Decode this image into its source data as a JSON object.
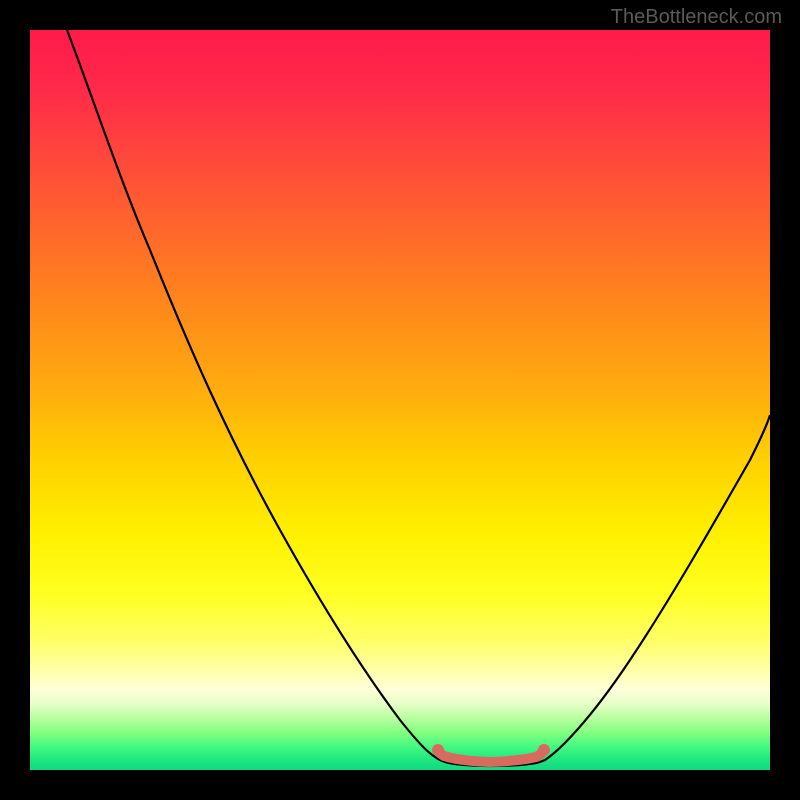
{
  "watermark": "TheBottleneck.com",
  "chart_data": {
    "type": "line",
    "title": "",
    "xlabel": "",
    "ylabel": "",
    "xlim": [
      0,
      100
    ],
    "ylim": [
      0,
      100
    ],
    "series": [
      {
        "name": "bottleneck-curve",
        "x": [
          5,
          10,
          15,
          20,
          25,
          30,
          35,
          40,
          45,
          50,
          53,
          55,
          58,
          61,
          64,
          67,
          70,
          75,
          80,
          85,
          90,
          95,
          100
        ],
        "y": [
          100,
          90,
          80,
          70,
          60,
          50,
          41,
          32,
          23,
          14,
          8,
          5,
          2,
          0,
          0,
          0,
          1,
          5,
          13,
          23,
          34,
          45,
          56
        ]
      },
      {
        "name": "optimal-zone-marker",
        "x": [
          55,
          56,
          58,
          60,
          62,
          64,
          66,
          68,
          69,
          70
        ],
        "y": [
          2.5,
          1.5,
          1,
          0.8,
          0.7,
          0.7,
          0.8,
          1,
          1.5,
          2.5
        ]
      }
    ],
    "gradient_stops": [
      {
        "pos": 0,
        "color": "#ff1a4a"
      },
      {
        "pos": 50,
        "color": "#ffd000"
      },
      {
        "pos": 80,
        "color": "#ffff60"
      },
      {
        "pos": 100,
        "color": "#10d880"
      }
    ]
  }
}
